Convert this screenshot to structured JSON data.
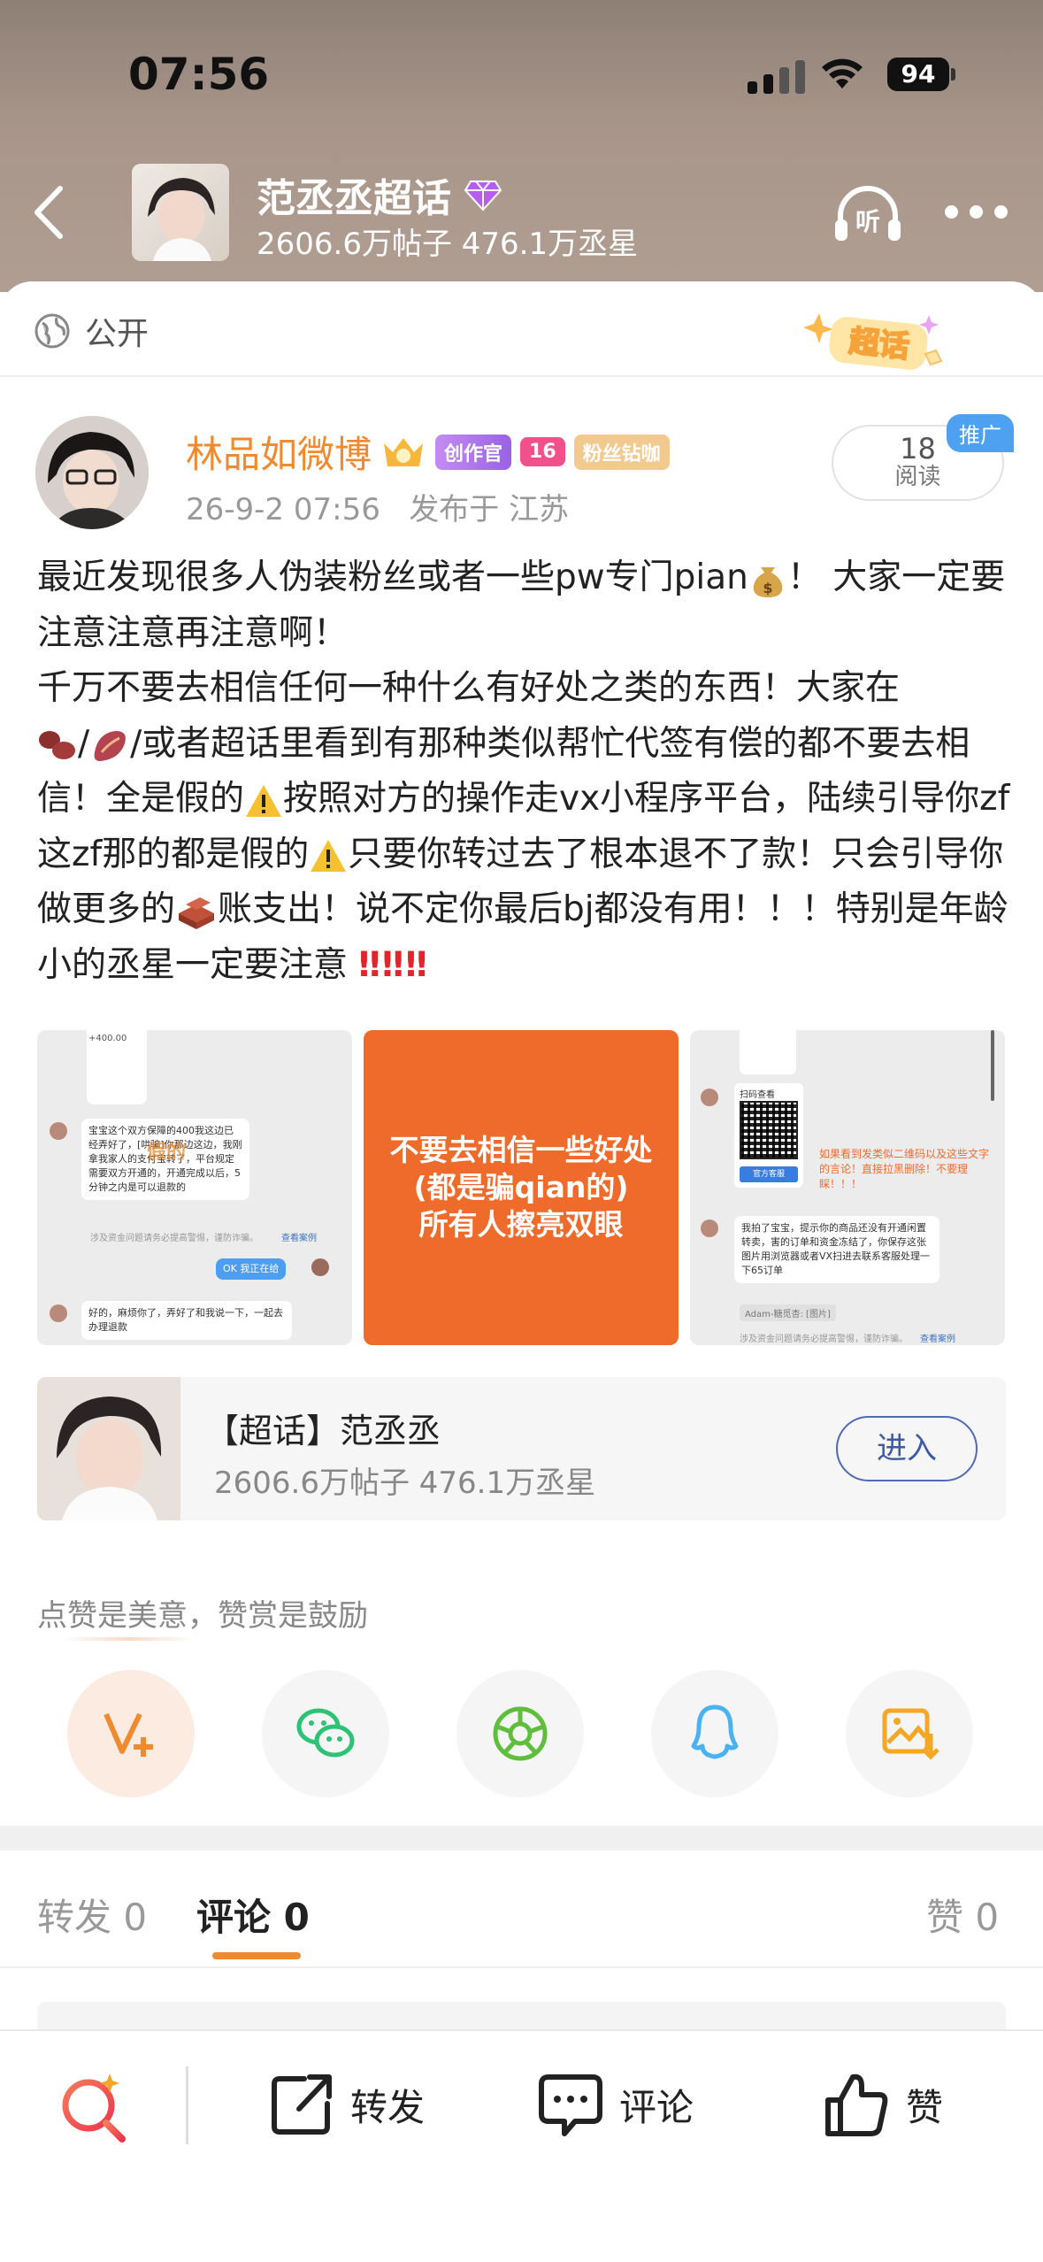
{
  "status_bar": {
    "time": "07:56",
    "battery": "94"
  },
  "topic": {
    "title": "范丞丞超话",
    "stats": "2606.6万帖子 476.1万丞星",
    "listen_label": "听"
  },
  "post": {
    "visibility": "公开",
    "super_tag": "超话",
    "author": "林品如微博",
    "badges": {
      "creator": "创作官",
      "level": "16",
      "fan": "粉丝钻咖"
    },
    "time": "26-9-2 07:56",
    "location": "发布于 江苏",
    "read_count": "18",
    "read_label": "阅读",
    "promo": "推广",
    "text": {
      "s1": "最近发现很多人伪装粉丝或者一些pw专门pian",
      "s2": "！ 大家一定要注意注意再注意啊！",
      "s3": "千万不要去相信任何一种什么有好处之类的东西！大家在",
      "s4": "/",
      "s5": "/或者超话里看到有那种类似帮忙代签有偿的都不要去相信！全是假的",
      "s6": "按照对方的操作走vx小程序平台，陆续引导你zf这zf那的都是假的",
      "s7": "只要你转过去了根本退不了款！只会引导你做更多的",
      "s8": "账支出！说不定你最后bj都没有用！！！特别是年龄小的丞星一定要注意"
    },
    "images": {
      "img1": {
        "amount": "+400.00",
        "msg1": "宝宝这个双方保障的400我这边已经弄好了，[哄骗]你那边这边，我刚拿我家人的支付宝转了，平台规定需要双方开通的，开通完成以后，5分钟之内是可以退款的",
        "warn": "涉及资金问题请务必提高警惕，谨防诈骗。",
        "warn_link": "查看案例",
        "reply": "OK 我正在给",
        "msg2": "好的，麻烦你了，弄好了和我说一下，一起去办理退款",
        "watermark": "假的"
      },
      "img2": {
        "text": "不要去相信一些好处\n(都是骗qian的)\n所有人擦亮双眼"
      },
      "img3": {
        "qr_title": "扫码查看",
        "qr_btn": "官方客服",
        "red_note": "如果看到发类似二维码以及这些文字的言论！直接拉黑删除！不要理睬！！！",
        "msg": "我拍了宝宝，提示你的商品还没有开通闲置转卖，害的订单和资金冻结了，你保存这张图片用浏览器或者VX扫进去联系客服处理一下65订单",
        "sender": "Adam-糖觅杏: [图片]",
        "warn": "涉及资金问题请务必提高警惕，谨防诈骗。",
        "warn_link": "查看案例"
      }
    }
  },
  "topic_card": {
    "title": "【超话】范丞丞",
    "stats": "2606.6万帖子 476.1万丞星",
    "enter": "进入"
  },
  "tip": "点赞是美意，赞赏是鼓励",
  "share_icons": [
    "v-plus-icon",
    "wechat-icon",
    "moments-icon",
    "qq-icon",
    "save-image-icon"
  ],
  "tabs": {
    "repost": "转发 0",
    "comment": "评论 0",
    "like": "赞 0"
  },
  "bottom_bar": {
    "repost": "转发",
    "comment": "评论",
    "like": "赞"
  },
  "colors": {
    "accent": "#f08a2e",
    "orange_banner": "#ef6b2b",
    "link_blue": "#3c5aa6"
  }
}
